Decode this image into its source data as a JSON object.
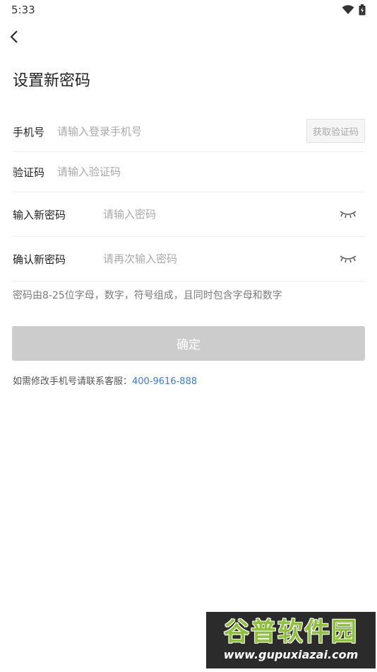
{
  "status_bar": {
    "time": "5:33",
    "wifi_icon": "wifi-icon",
    "battery_icon": "battery-icon"
  },
  "nav": {
    "back_icon": "back-arrow-icon"
  },
  "page_title": "设置新密码",
  "form": {
    "phone": {
      "label": "手机号",
      "placeholder": "请输入登录手机号",
      "value": "",
      "code_button": "获取验证码"
    },
    "code": {
      "label": "验证码",
      "placeholder": "请输入验证码",
      "value": ""
    },
    "new_password": {
      "label": "输入新密码",
      "placeholder": "请输入密码",
      "value": "",
      "toggle_icon": "eye-closed-icon"
    },
    "confirm_password": {
      "label": "确认新密码",
      "placeholder": "请再次输入密码",
      "value": "",
      "toggle_icon": "eye-closed-icon"
    }
  },
  "hint": "密码由8-25位字母，数字，符号组成，且同时包含字母和数字",
  "confirm_button": "确定",
  "contact": {
    "text": "如需修改手机号请联系客服：",
    "phone": "400-9616-888"
  },
  "watermark": {
    "main": "谷普软件园",
    "url": "www.gupuxiazai.com"
  },
  "colors": {
    "link": "#3a7dd8",
    "disabled_button": "#cccccc",
    "placeholder": "#a8a8a8",
    "watermark_green": "#8fc03a"
  }
}
